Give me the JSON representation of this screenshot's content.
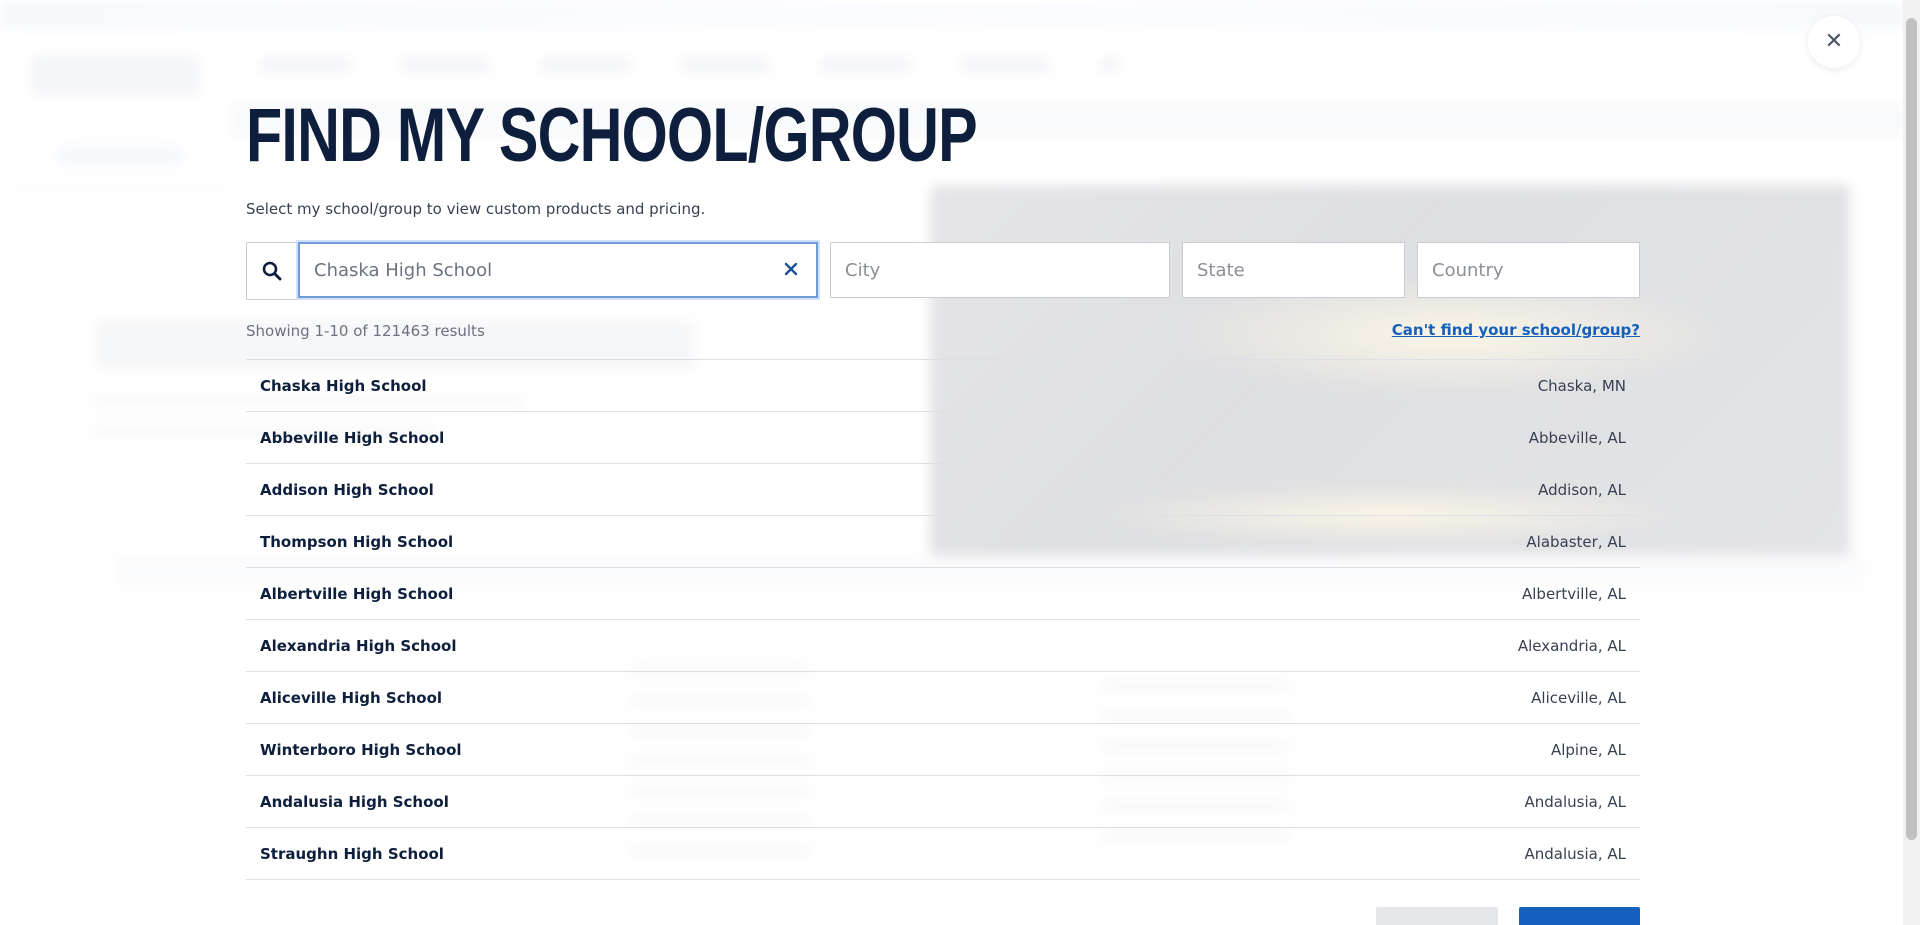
{
  "modal": {
    "title": "FIND MY SCHOOL/GROUP",
    "subtitle": "Select my school/group to view custom products and pricing."
  },
  "search": {
    "name_value": "Chaska High School",
    "city_placeholder": "City",
    "state_placeholder": "State",
    "country_placeholder": "Country"
  },
  "results": {
    "count_text": "Showing 1-10 of 121463 results",
    "cant_find_link": "Can't find your school/group?",
    "items": [
      {
        "name": "Chaska High School",
        "location": "Chaska, MN"
      },
      {
        "name": "Abbeville High School",
        "location": "Abbeville, AL"
      },
      {
        "name": "Addison High School",
        "location": "Addison, AL"
      },
      {
        "name": "Thompson High School",
        "location": "Alabaster, AL"
      },
      {
        "name": "Albertville High School",
        "location": "Albertville, AL"
      },
      {
        "name": "Alexandria High School",
        "location": "Alexandria, AL"
      },
      {
        "name": "Aliceville High School",
        "location": "Aliceville, AL"
      },
      {
        "name": "Winterboro High School",
        "location": "Alpine, AL"
      },
      {
        "name": "Andalusia High School",
        "location": "Andalusia, AL"
      },
      {
        "name": "Straughn High School",
        "location": "Andalusia, AL"
      }
    ]
  },
  "icons": {
    "search": "search-icon",
    "clear": "close-icon",
    "close_modal": "close-icon"
  },
  "colors": {
    "title": "#0d1f3c",
    "link": "#1560bd",
    "focus_border": "#6d9bd8"
  }
}
